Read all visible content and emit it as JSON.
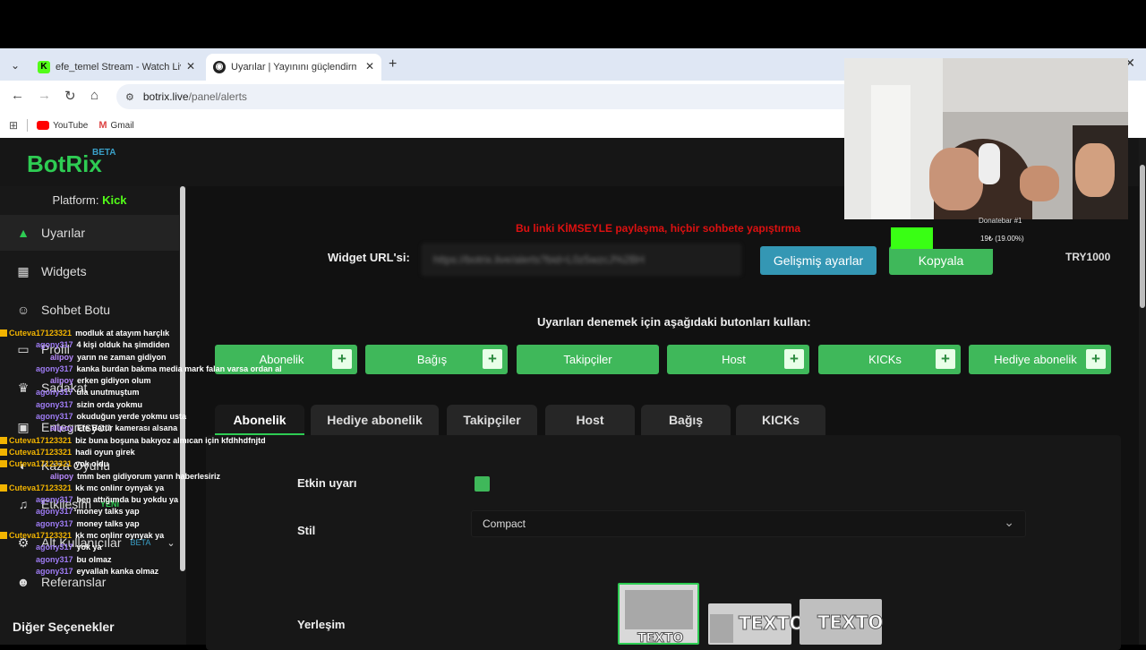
{
  "browser": {
    "tabs": [
      {
        "title": "efe_temel Stream - Watch Live o",
        "favicon": "K"
      },
      {
        "title": "Uyarılar | Yayınını güçlendirmek",
        "favicon": "◉"
      }
    ],
    "url_host": "botrix.live",
    "url_path": "/panel/alerts",
    "bookmarks": [
      {
        "label": "YouTube"
      },
      {
        "label": "Gmail"
      }
    ]
  },
  "app": {
    "logo": "BotRix",
    "logo_badge": "BETA",
    "platform_label": "Platform:",
    "platform_value": "Kick"
  },
  "sidebar": {
    "items": [
      {
        "label": "Uyarılar",
        "icon": "warning-icon",
        "glyph": "▲"
      },
      {
        "label": "Widgets",
        "icon": "grid-icon",
        "glyph": "▦"
      },
      {
        "label": "Sohbet Botu",
        "icon": "robot-icon",
        "glyph": "☺"
      },
      {
        "label": "Profil",
        "icon": "id-card-icon",
        "glyph": "▭"
      },
      {
        "label": "Sadakat",
        "icon": "trophy-icon",
        "glyph": "♛"
      },
      {
        "label": "Entegrasyon",
        "icon": "chat-icon",
        "glyph": "▣"
      },
      {
        "label": "Kaza Oyunu",
        "icon": "toggle-icon",
        "glyph": "◐"
      },
      {
        "label": "Etkileşim",
        "icon": "music-icon",
        "glyph": "♫",
        "badge": "YENİ"
      },
      {
        "label": "Alt Kullanıcılar",
        "icon": "users-icon",
        "glyph": "⚙",
        "badge": "BETA"
      },
      {
        "label": "Referanslar",
        "icon": "people-icon",
        "glyph": "☻"
      }
    ],
    "other_heading": "Diğer Seçenekler"
  },
  "main": {
    "warning": "Bu linki KİMSEYLE paylaşma, hiçbir sohbete yapıştırma",
    "widget_label": "Widget URL'si:",
    "widget_url": "https://botrix.live/alerts?bid=L0z5wzcJ%2BH",
    "advanced_button": "Gelişmiş ayarlar",
    "copy_button": "Kopyala",
    "test_hint": "Uyarıları denemek için aşağıdaki butonları kullan:",
    "test_buttons": [
      "Abonelik",
      "Bağış",
      "Takipçiler",
      "Host",
      "KICKs",
      "Hediye abonelik"
    ],
    "tabs": [
      "Abonelik",
      "Hediye abonelik",
      "Takipçiler",
      "Host",
      "Bağış",
      "KICKs"
    ],
    "fields": {
      "enabled_label": "Etkin uyarı",
      "style_label": "Stil",
      "style_value": "Compact",
      "layout_label": "Yerleşim",
      "layout_text": "TEXTO"
    }
  },
  "overlay": {
    "donation_title": "Donatebar #1",
    "donation_text": "19₺ (19.00%)",
    "donation_progress": 0.19,
    "currency_goal": "TRY1000",
    "chat": [
      {
        "user": "Cuteva17123321",
        "msg": "modluk at atayım harçlık",
        "type": "cut"
      },
      {
        "user": "agony317",
        "msg": "4 kişi olduk ha şimdiden",
        "type": "agony"
      },
      {
        "user": "alipoy",
        "msg": "yarın ne zaman gidiyon",
        "type": "alipoy"
      },
      {
        "user": "agony317",
        "msg": "kanka burdan bakma media mark falan varsa ordan al",
        "type": "agony"
      },
      {
        "user": "alipoy",
        "msg": "erken gidiyon olum",
        "type": "alipoy"
      },
      {
        "user": "agony317",
        "msg": "ula unutmuştum",
        "type": "agony"
      },
      {
        "user": "agony317",
        "msg": "sizin orda yokmu",
        "type": "agony"
      },
      {
        "user": "agony317",
        "msg": "okuduğun yerde yokmu usta",
        "type": "agony"
      },
      {
        "user": "alipoy",
        "msg": "Efe Batur kamerası alsana",
        "type": "alipoy"
      },
      {
        "user": "Cuteva17123321",
        "msg": "biz buna boşuna bakıyoz almıcan için kfdhhdfnjtd",
        "type": "cut"
      },
      {
        "user": "Cuteva17123321",
        "msg": "hadi oyun girek",
        "type": "cut"
      },
      {
        "user": "Cuteva17123321",
        "msg": "yok oldu",
        "type": "cut"
      },
      {
        "user": "alipoy",
        "msg": "tmm ben gidiyorum yarın haberlesiriz",
        "type": "alipoy"
      },
      {
        "user": "Cuteva17123321",
        "msg": "kk mc onlinr oynyak ya",
        "type": "cut"
      },
      {
        "user": "agony317",
        "msg": "ben attığımda bu yokdu ya",
        "type": "agony"
      },
      {
        "user": "agony317",
        "msg": "money talks yap",
        "type": "agony"
      },
      {
        "user": "agony317",
        "msg": "money talks yap",
        "type": "agony"
      },
      {
        "user": "Cuteva17123321",
        "msg": "kk mc onlinr oynyak ya",
        "type": "cut"
      },
      {
        "user": "agony317",
        "msg": "yok ya",
        "type": "agony"
      },
      {
        "user": "agony317",
        "msg": "bu olmaz",
        "type": "agony"
      },
      {
        "user": "agony317",
        "msg": "eyvallah kanka olmaz",
        "type": "agony"
      }
    ]
  },
  "colors": {
    "brand_green": "#2ecc53",
    "kick_green": "#53fc18",
    "accent_blue": "#3497b4",
    "warning_red": "#d11111"
  }
}
